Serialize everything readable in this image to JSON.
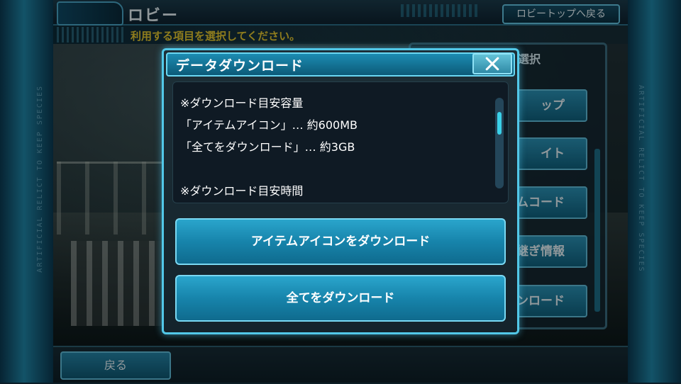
{
  "side": {
    "vertical_text": "ARTIFICIAL RELICT TO KEEP SPECIES"
  },
  "header": {
    "title": "ロビー",
    "top_button_label": "ロビートップへ戻る",
    "instruction": "利用する項目を選択してください。"
  },
  "menu": {
    "title": "選択",
    "items": [
      {
        "label": "ップ"
      },
      {
        "label": "イト"
      },
      {
        "label": "ムコード"
      },
      {
        "label": "継ぎ情報"
      },
      {
        "label": "ウンロード"
      }
    ]
  },
  "dialog": {
    "title": "データダウンロード",
    "close_icon": "close-icon",
    "info_lines": [
      "※ダウンロード目安容量",
      "「アイテムアイコン」… 約600MB",
      "「全てをダウンロード」… 約3GB",
      "",
      "※ダウンロード目安時間"
    ],
    "buttons": [
      {
        "label": "アイテムアイコンをダウンロード"
      },
      {
        "label": "全てをダウンロード"
      }
    ]
  },
  "footer": {
    "back_label": "戻る"
  },
  "colors": {
    "accent": "#52c8e8",
    "instruction_text": "#e6c830",
    "button_fill": "#1784ab",
    "side_stripe": "#1f86a8"
  }
}
